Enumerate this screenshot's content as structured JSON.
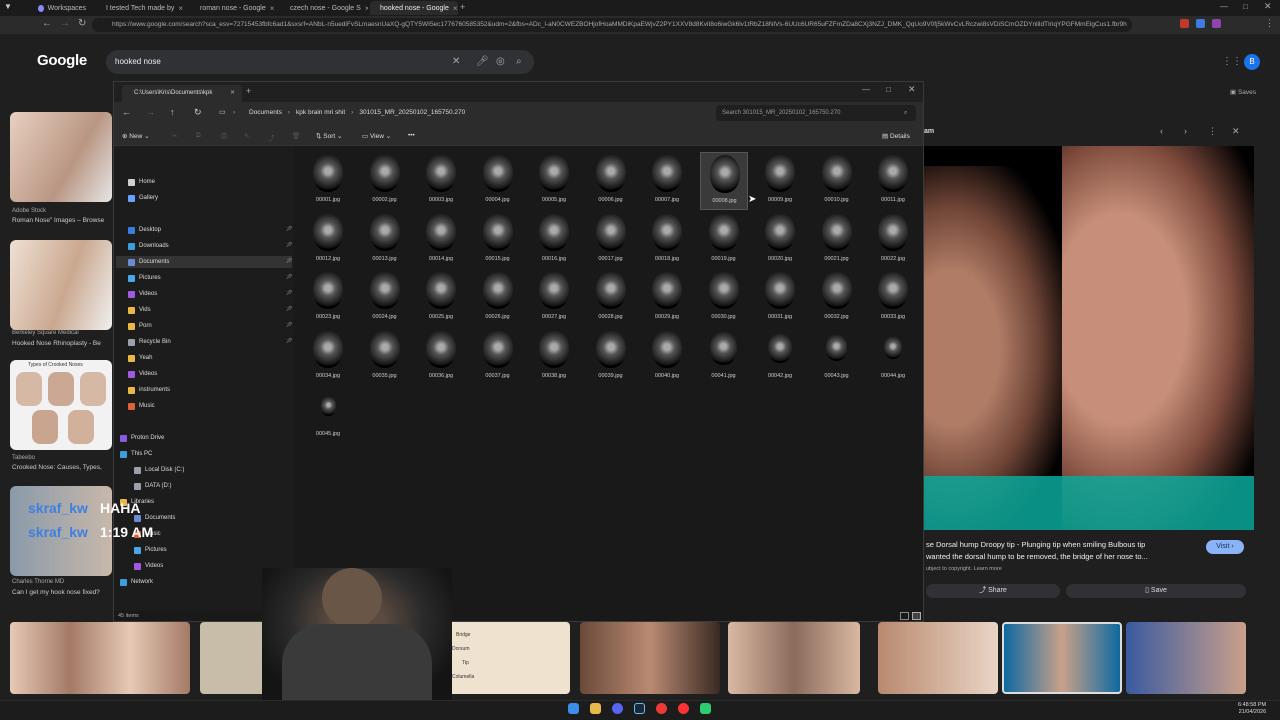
{
  "browser": {
    "tabs": [
      {
        "label": "Workspaces",
        "color": "#8888ff"
      },
      {
        "label": "I tested Tech made by",
        "color": "#ff3333"
      },
      {
        "label": "roman nose - Google",
        "color": "#4285f4"
      },
      {
        "label": "czech nose - Google S",
        "color": "#4285f4"
      },
      {
        "label": "hooked nose - Google",
        "color": "#4285f4"
      }
    ],
    "url": "https://www.google.com/search?sca_esv=72715453fbfc6ad1&sxsrf=ANbL-n5uediFvSLmaesnUaXQ-gQTY5WI5ec1776760585352&udm=2&fbs=ADc_l-aN0CWEZBOHjofHoaMMDiKpaEWjvZ2PY1XXV8d8KvlI8o6iwGk6lv1tRbZ18NlVs-6UUc6UR65uFZFmZDa8CXj3NZJ_DMK_QqUo9V0fj5kWvCvLRczwi8sVDiSCmOZDYnlildTIriqYPGFMmElgCus1.fbr9h"
  },
  "google": {
    "logo": "Google",
    "query": "hooked nose",
    "avatar": "B",
    "saves": "Saves",
    "left_results": [
      {
        "source": "Adobe Stock",
        "title": "Roman Nose\" Images – Browse"
      },
      {
        "source": "Berkeley Square Medical",
        "title": "Hooked Nose Rhinoplasty - Be"
      },
      {
        "source": "Tabeebo",
        "title": "Crooked Nose: Causes, Types,"
      },
      {
        "source": "Charles Thorne MD",
        "title": "Can I get my hook nose fixed?"
      }
    ],
    "crooked_types_label": "Types of Crooked Noses",
    "preview": {
      "caption_line1": "se Dorsal hump Droopy tip - Plunging tip when smiling Bulbous tip",
      "caption_line2": "wanted the dorsal hump to be removed, the bridge of her nose to...",
      "copyright": "ubject to copyright. Learn more",
      "visit": "Visit",
      "share": "Share",
      "save": "Save",
      "header_fragment": "am"
    },
    "diagram_labels": [
      "Bridge",
      "Dorsum",
      "Tip",
      "Columella"
    ]
  },
  "explorer": {
    "tab_title": "C:\\Users\\Kris\\Documents\\kpk",
    "breadcrumbs": [
      "Documents",
      "kpk brain mri shit",
      "301015_MR_20250102_165750.270"
    ],
    "search_placeholder": "Search 301015_MR_20250102_165750.270",
    "toolbar": {
      "new": "New",
      "sort": "Sort",
      "view": "View",
      "more": "•••",
      "details": "Details"
    },
    "nav": [
      {
        "label": "Home",
        "color": "#d0d0d0"
      },
      {
        "label": "Gallery",
        "color": "#6aa0ff"
      },
      {
        "label": "Desktop",
        "color": "#3d7be0"
      },
      {
        "label": "Downloads",
        "color": "#3d9be0"
      },
      {
        "label": "Documents",
        "color": "#6c8bd6"
      },
      {
        "label": "Pictures",
        "color": "#4aa6e8"
      },
      {
        "label": "Videos",
        "color": "#a05ae0"
      },
      {
        "label": "Vids",
        "color": "#e8b84a"
      },
      {
        "label": "Porn",
        "color": "#e8b84a"
      },
      {
        "label": "Recycle Bin",
        "color": "#9aa0a8"
      },
      {
        "label": "Yeah",
        "color": "#e8b84a"
      },
      {
        "label": "Videos",
        "color": "#a05ae0"
      },
      {
        "label": "instruments",
        "color": "#e8b84a"
      },
      {
        "label": "Music",
        "color": "#e0603a"
      },
      {
        "label": "Proton Drive",
        "color": "#8a5ae0"
      },
      {
        "label": "This PC",
        "color": "#3d9be0"
      },
      {
        "label": "Local Disk (C:)",
        "color": "#9aa0a8"
      },
      {
        "label": "DATA (D:)",
        "color": "#9aa0a8"
      },
      {
        "label": "Libraries",
        "color": "#e8b84a"
      },
      {
        "label": "Documents",
        "color": "#6c8bd6"
      },
      {
        "label": "Music",
        "color": "#e0603a"
      },
      {
        "label": "Pictures",
        "color": "#4aa6e8"
      },
      {
        "label": "Videos",
        "color": "#a05ae0"
      },
      {
        "label": "Network",
        "color": "#3d9be0"
      }
    ],
    "files": [
      "00001.jpg",
      "00002.jpg",
      "00003.jpg",
      "00004.jpg",
      "00005.jpg",
      "00006.jpg",
      "00007.jpg",
      "00008.jpg",
      "00009.jpg",
      "00010.jpg",
      "00011.jpg",
      "00012.jpg",
      "00013.jpg",
      "00014.jpg",
      "00015.jpg",
      "00016.jpg",
      "00017.jpg",
      "00018.jpg",
      "00019.jpg",
      "00020.jpg",
      "00021.jpg",
      "00022.jpg",
      "00023.jpg",
      "00024.jpg",
      "00025.jpg",
      "00026.jpg",
      "00027.jpg",
      "00028.jpg",
      "00029.jpg",
      "00030.jpg",
      "00031.jpg",
      "00032.jpg",
      "00033.jpg",
      "00034.jpg",
      "00035.jpg",
      "00036.jpg",
      "00037.jpg",
      "00038.jpg",
      "00039.jpg",
      "00040.jpg",
      "00041.jpg",
      "00042.jpg",
      "00043.jpg",
      "00044.jpg",
      "00045.jpg"
    ],
    "selected_file": "00008.jpg",
    "status": "45 items"
  },
  "stream_overlay": {
    "name1": "skraf_kw",
    "name2": "skraf_kw",
    "haha": "HAHA",
    "clock": "1:19 AM"
  },
  "taskbar": {
    "time": "6:48:58 PM",
    "date": "21/04/2026"
  }
}
